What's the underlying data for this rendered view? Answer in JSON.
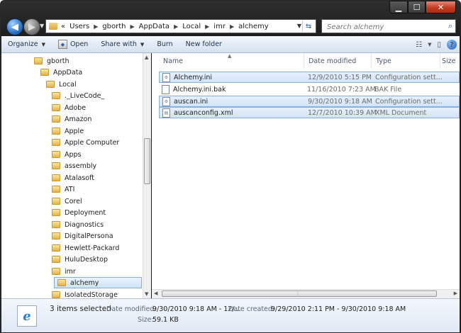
{
  "window": {
    "controls": {
      "minimize": "▁",
      "maximize": "☐",
      "close": "✕"
    }
  },
  "address": {
    "chevron": "«",
    "crumbs": [
      "Users",
      "gborth",
      "AppData",
      "Local",
      "imr",
      "alchemy"
    ]
  },
  "search": {
    "placeholder": "Search alchemy"
  },
  "toolbar": {
    "organize": "Organize",
    "open": "Open",
    "share_with": "Share with",
    "burn": "Burn",
    "new_folder": "New folder"
  },
  "tree": {
    "items": [
      "gborth",
      "AppData",
      "Local",
      "._LiveCode_",
      "Adobe",
      "Amazon",
      "Apple",
      "Apple Computer",
      "Apps",
      "assembly",
      "Atalasoft",
      "ATI",
      "Corel",
      "Deployment",
      "Diagnostics",
      "DigitalPersona",
      "Hewlett-Packard",
      "HuluDesktop",
      "imr",
      "alchemy",
      "IsolatedStorage"
    ],
    "selected": "alchemy"
  },
  "columns": {
    "name": "Name",
    "date": "Date modified",
    "type": "Type",
    "size": "Size"
  },
  "files": [
    {
      "name": "Alchemy.ini",
      "date": "12/9/2010 5:15 PM",
      "type": "Configuration sett...",
      "selected": true
    },
    {
      "name": "Alchemy.ini.bak",
      "date": "11/16/2010 7:23 AM",
      "type": "BAK File",
      "selected": false
    },
    {
      "name": "auscan.ini",
      "date": "9/30/2010 9:18 AM",
      "type": "Configuration sett...",
      "selected": true
    },
    {
      "name": "auscanconfig.xml",
      "date": "12/7/2010 10:39 AM",
      "type": "XML Document",
      "selected": true
    }
  ],
  "details": {
    "selection": "3 items selected",
    "date_modified_label": "Date modified:",
    "date_modified_value": "9/30/2010 9:18 AM - 12/...",
    "date_created_label": "Date created:",
    "date_created_value": "9/29/2010 2:11 PM - 9/30/2010 9:18 AM",
    "size_label": "Size:",
    "size_value": "59.1 KB"
  },
  "colors": {
    "selection": "#d3e4f9",
    "selection_border": "#88b0e0",
    "folder": "#e2b247",
    "toolbar_text": "#1e3050"
  }
}
